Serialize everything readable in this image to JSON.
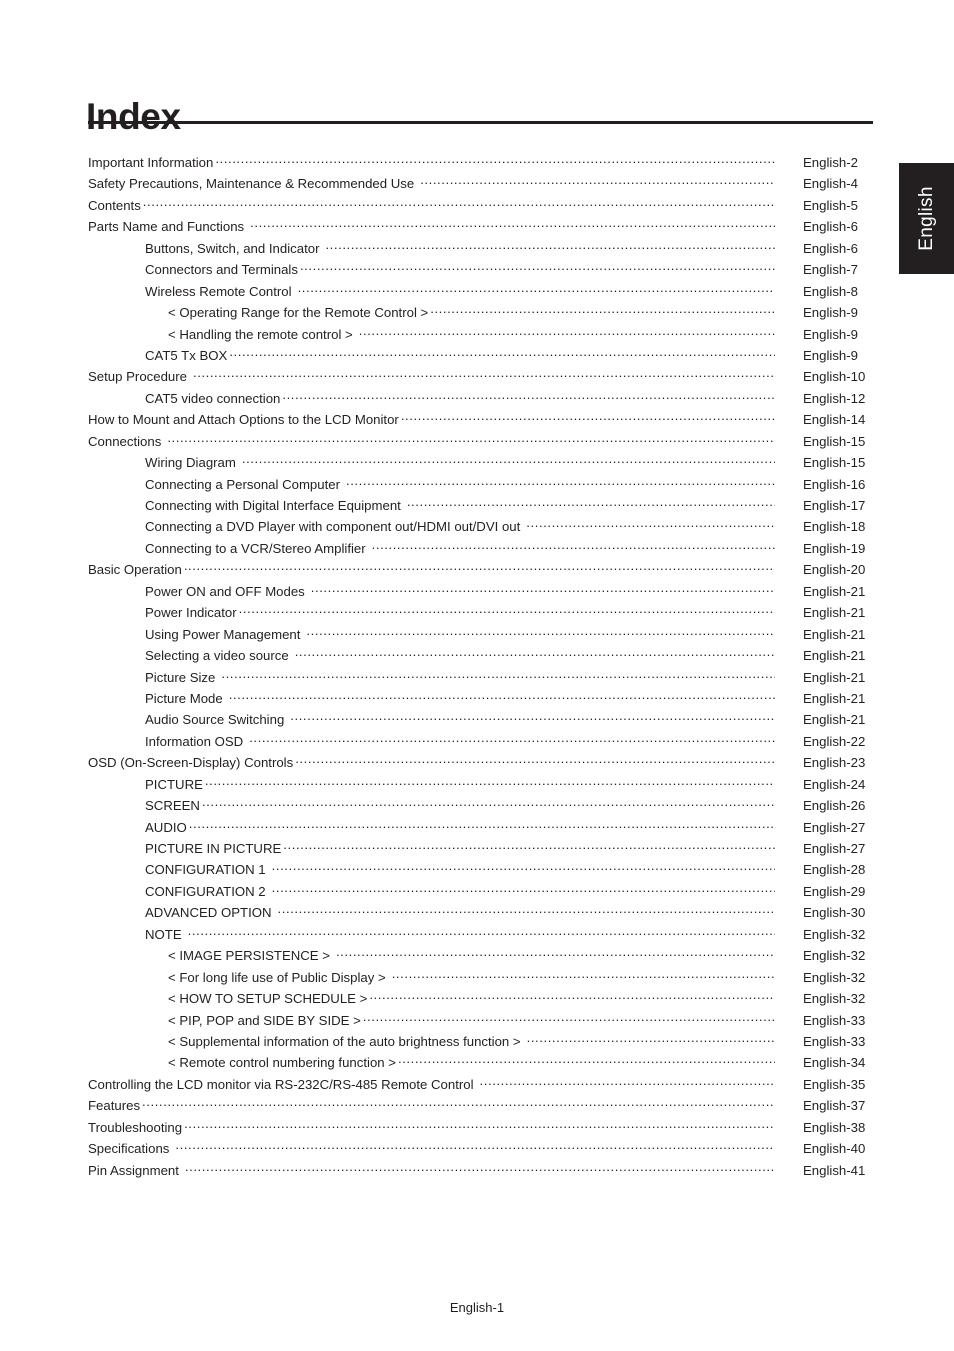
{
  "page_title": "Index",
  "language_tab": "English",
  "footer": "English-1",
  "index": {
    "entries": [
      {
        "level": 0,
        "title": "Important Information",
        "page": "English-2",
        "gap": false
      },
      {
        "level": 0,
        "title": "Safety Precautions, Maintenance & Recommended Use",
        "page": "English-4",
        "gap": true
      },
      {
        "level": 0,
        "title": "Contents",
        "page": "English-5",
        "gap": false
      },
      {
        "level": 0,
        "title": "Parts Name and Functions",
        "page": "English-6",
        "gap": true
      },
      {
        "level": 1,
        "title": "Buttons, Switch, and Indicator",
        "page": "English-6",
        "gap": true
      },
      {
        "level": 1,
        "title": "Connectors and Terminals",
        "page": "English-7",
        "gap": false
      },
      {
        "level": 1,
        "title": "Wireless Remote Control",
        "page": "English-8",
        "gap": true
      },
      {
        "level": 2,
        "title": "< Operating Range for the Remote Control >",
        "page": "English-9",
        "gap": false
      },
      {
        "level": 2,
        "title": "< Handling the remote control >",
        "page": "English-9",
        "gap": true
      },
      {
        "level": 1,
        "title": "CAT5 Tx BOX",
        "page": "English-9",
        "gap": false
      },
      {
        "level": 0,
        "title": "Setup Procedure",
        "page": "English-10",
        "gap": true
      },
      {
        "level": 1,
        "title": "CAT5 video connection",
        "page": "English-12",
        "gap": false
      },
      {
        "level": 0,
        "title": "How to Mount and Attach Options to the LCD Monitor",
        "page": "English-14",
        "gap": false
      },
      {
        "level": 0,
        "title": "Connections",
        "page": "English-15",
        "gap": true
      },
      {
        "level": 1,
        "title": "Wiring Diagram",
        "page": "English-15",
        "gap": true
      },
      {
        "level": 1,
        "title": "Connecting a Personal Computer",
        "page": "English-16",
        "gap": true
      },
      {
        "level": 1,
        "title": "Connecting with Digital Interface Equipment",
        "page": "English-17",
        "gap": true
      },
      {
        "level": 1,
        "title": "Connecting a DVD Player with component out/HDMI out/DVI out",
        "page": "English-18",
        "gap": true
      },
      {
        "level": 1,
        "title": "Connecting to a VCR/Stereo Amplifier",
        "page": "English-19",
        "gap": true
      },
      {
        "level": 0,
        "title": "Basic Operation",
        "page": "English-20",
        "gap": false
      },
      {
        "level": 1,
        "title": "Power ON and OFF Modes",
        "page": "English-21",
        "gap": true
      },
      {
        "level": 1,
        "title": "Power Indicator",
        "page": "English-21",
        "gap": false
      },
      {
        "level": 1,
        "title": "Using Power Management",
        "page": "English-21",
        "gap": true
      },
      {
        "level": 1,
        "title": "Selecting a video source",
        "page": "English-21",
        "gap": true
      },
      {
        "level": 1,
        "title": "Picture Size",
        "page": "English-21",
        "gap": true
      },
      {
        "level": 1,
        "title": "Picture Mode",
        "page": "English-21",
        "gap": true
      },
      {
        "level": 1,
        "title": "Audio Source Switching",
        "page": "English-21",
        "gap": true
      },
      {
        "level": 1,
        "title": "Information OSD",
        "page": "English-22",
        "gap": true
      },
      {
        "level": 0,
        "title": "OSD (On-Screen-Display) Controls",
        "page": "English-23",
        "gap": false
      },
      {
        "level": 1,
        "title": "PICTURE",
        "page": "English-24",
        "gap": false
      },
      {
        "level": 1,
        "title": "SCREEN",
        "page": "English-26",
        "gap": false
      },
      {
        "level": 1,
        "title": "AUDIO",
        "page": "English-27",
        "gap": false
      },
      {
        "level": 1,
        "title": "PICTURE IN PICTURE",
        "page": "English-27",
        "gap": false
      },
      {
        "level": 1,
        "title": "CONFIGURATION 1",
        "page": "English-28",
        "gap": true
      },
      {
        "level": 1,
        "title": "CONFIGURATION 2",
        "page": "English-29",
        "gap": true
      },
      {
        "level": 1,
        "title": "ADVANCED OPTION",
        "page": "English-30",
        "gap": true
      },
      {
        "level": 1,
        "title": "NOTE",
        "page": "English-32",
        "gap": true
      },
      {
        "level": 2,
        "title": "< IMAGE PERSISTENCE >",
        "page": "English-32",
        "gap": true
      },
      {
        "level": 2,
        "title": "< For long life use of Public Display >",
        "page": "English-32",
        "gap": true
      },
      {
        "level": 2,
        "title": "< HOW TO SETUP SCHEDULE >",
        "page": "English-32",
        "gap": false
      },
      {
        "level": 2,
        "title": "< PIP, POP and SIDE BY SIDE >",
        "page": "English-33",
        "gap": false
      },
      {
        "level": 2,
        "title": "< Supplemental information of the auto brightness function >",
        "page": "English-33",
        "gap": true
      },
      {
        "level": 2,
        "title": "< Remote control numbering function >",
        "page": "English-34",
        "gap": false
      },
      {
        "level": 0,
        "title": "Controlling the LCD monitor via RS-232C/RS-485 Remote Control",
        "page": "English-35",
        "gap": true
      },
      {
        "level": 0,
        "title": "Features",
        "page": "English-37",
        "gap": false
      },
      {
        "level": 0,
        "title": "Troubleshooting",
        "page": "English-38",
        "gap": false
      },
      {
        "level": 0,
        "title": "Specifications",
        "page": "English-40",
        "gap": true
      },
      {
        "level": 0,
        "title": "Pin Assignment",
        "page": "English-41",
        "gap": true
      }
    ]
  }
}
